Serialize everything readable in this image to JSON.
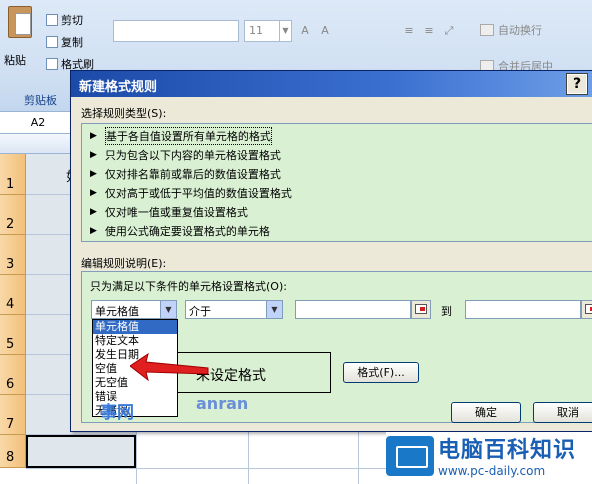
{
  "ribbon": {
    "paste_label": "粘贴",
    "cut_label": "剪切",
    "copy_label": "复制",
    "format_painter_label": "格式刷",
    "clipboard_group_label": "剪贴板",
    "font_size_value": "11",
    "wrap_text_label": "自动换行",
    "merge_label": "合并后居中"
  },
  "sheet": {
    "namebox_value": "A2",
    "row_numbers": [
      "1",
      "2",
      "3",
      "4",
      "5",
      "6",
      "7",
      "8"
    ],
    "cell_a1_text": "如"
  },
  "dialog": {
    "title": "新建格式规则",
    "help_label": "?",
    "rule_type_label": "选择规则类型(S):",
    "rule_types": [
      "基于各自值设置所有单元格的格式",
      "只为包含以下内容的单元格设置格式",
      "仅对排名靠前或靠后的数值设置格式",
      "仅对高于或低于平均值的数值设置格式",
      "仅对唯一值或重复值设置格式",
      "使用公式确定要设置格式的单元格"
    ],
    "edit_desc_label": "编辑规则说明(E):",
    "only_format_label": "只为满足以下条件的单元格设置格式(O):",
    "condition_type_value": "单元格值",
    "operator_value": "介于",
    "to_label": "到",
    "preview_text": "未设定格式",
    "format_button": "格式(F)...",
    "ok_button": "确定",
    "cancel_button": "取消",
    "dropdown_options": [
      "单元格值",
      "特定文本",
      "发生日期",
      "空值",
      "无空值",
      "错误",
      "无错误"
    ]
  },
  "watermarks": {
    "brand_title": "电脑百科知识",
    "brand_url": "www.pc-daily.com",
    "mid_text": "事网",
    "mid_text2": "anran"
  },
  "colors": {
    "title_bar": "#1c4aa8",
    "dialog_bg": "#ece9d8",
    "list_bg": "#d9f0d3",
    "selection": "#316ac5",
    "arrow": "#e02020"
  }
}
